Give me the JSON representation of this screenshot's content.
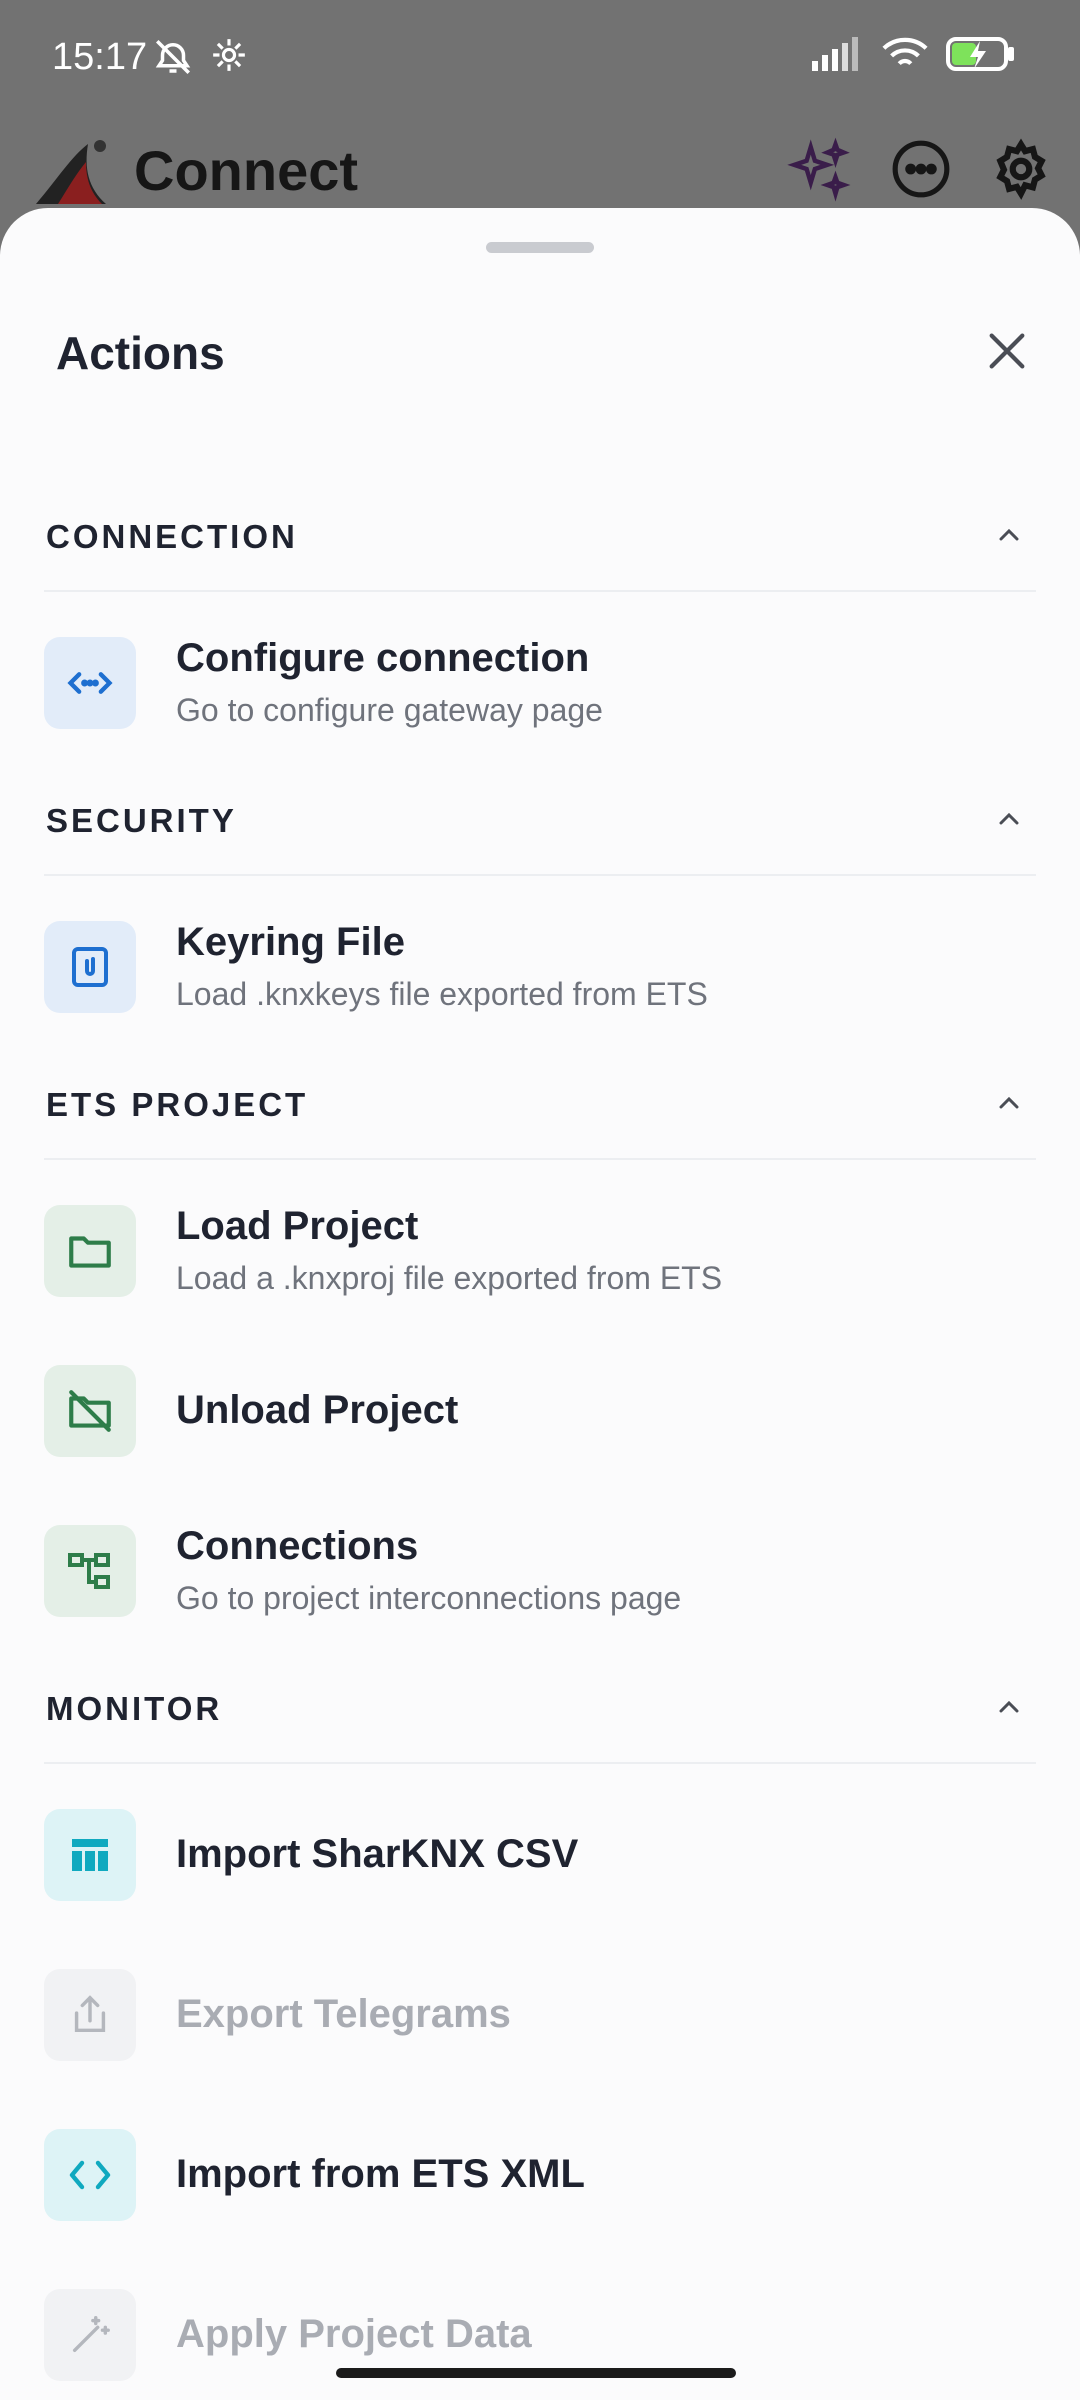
{
  "status_bar": {
    "time": "15:17"
  },
  "app_header": {
    "title": "Connect"
  },
  "sheet": {
    "title": "Actions"
  },
  "sections": {
    "connection": {
      "label": "CONNECTION",
      "items": [
        {
          "title": "Configure connection",
          "subtitle": "Go to configure gateway page"
        }
      ]
    },
    "security": {
      "label": "SECURITY",
      "items": [
        {
          "title": "Keyring File",
          "subtitle": "Load .knxkeys file exported from ETS"
        }
      ]
    },
    "ets_project": {
      "label": "ETS PROJECT",
      "items": [
        {
          "title": "Load Project",
          "subtitle": "Load a .knxproj file exported from ETS"
        },
        {
          "title": "Unload Project"
        },
        {
          "title": "Connections",
          "subtitle": "Go to project interconnections page"
        }
      ]
    },
    "monitor": {
      "label": "MONITOR",
      "items": [
        {
          "title": "Import SharKNX CSV"
        },
        {
          "title": "Export Telegrams",
          "disabled": true
        },
        {
          "title": "Import from ETS XML"
        },
        {
          "title": "Apply Project Data",
          "disabled": true
        }
      ]
    }
  },
  "colors": {
    "blue_accent": "#1e6fd0",
    "green_accent": "#2e7d4a",
    "cyan_accent": "#10a9bf",
    "disabled": "#a9acb3"
  }
}
